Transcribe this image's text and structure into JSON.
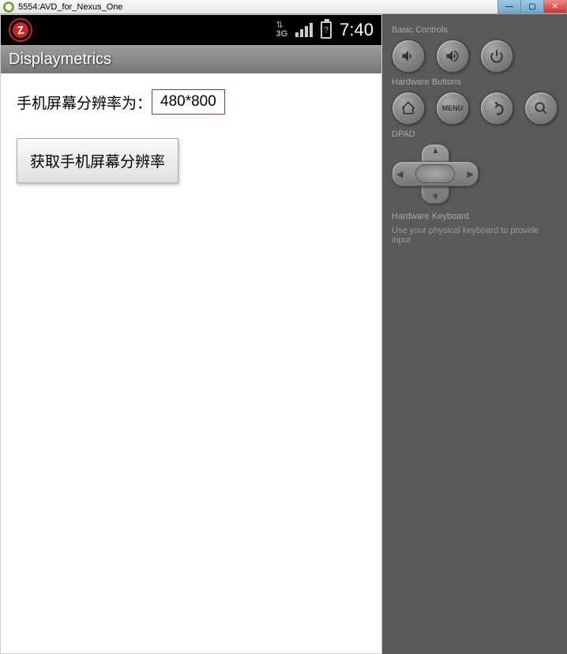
{
  "window": {
    "title": "5554:AVD_for_Nexus_One"
  },
  "status_bar": {
    "network": "3G",
    "battery_state": "?",
    "clock": "7:40",
    "logo_letter": "Z"
  },
  "app": {
    "title": "Displaymetrics",
    "resolution_label": "手机屏幕分辨率为：",
    "resolution_value": "480*800",
    "get_button": "获取手机屏幕分辨率"
  },
  "panel": {
    "basic_controls": "Basic Controls",
    "hardware_buttons": "Hardware Buttons",
    "dpad": "DPAD",
    "hardware_keyboard": "Hardware Keyboard",
    "keyboard_hint": "Use your physical keyboard to provide input",
    "menu_label": "MENU"
  }
}
